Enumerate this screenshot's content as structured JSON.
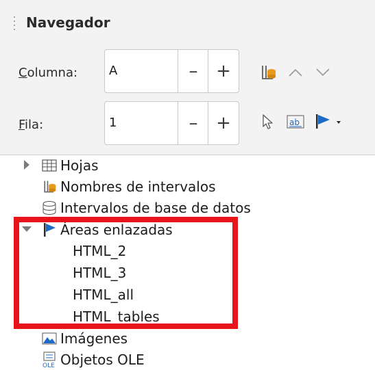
{
  "header": {
    "title": "Navegador"
  },
  "controls": {
    "column_label": "Columna:",
    "column_accel": "C",
    "column_rest": "olumna:",
    "column_value": "A",
    "row_label": "Fila:",
    "row_accel": "F",
    "row_rest": "ila:",
    "row_value": "1",
    "minus": "–",
    "plus": "+"
  },
  "tree": {
    "items": [
      {
        "label": "Hojas",
        "icon": "sheet-grid-icon",
        "expanded": false
      },
      {
        "label": "Nombres de intervalos",
        "icon": "range-names-icon"
      },
      {
        "label": "Intervalos de base de datos",
        "icon": "database-icon"
      },
      {
        "label": "Áreas enlazadas",
        "icon": "linked-area-flag-icon",
        "expanded": true,
        "children": [
          "HTML_2",
          "HTML_3",
          "HTML_all",
          "HTML_tables"
        ]
      },
      {
        "label": "Imágenes",
        "icon": "image-icon"
      },
      {
        "label": "Objetos OLE",
        "icon": "ole-object-icon"
      }
    ]
  },
  "colors": {
    "highlight": "#e8141c",
    "accent_blue": "#1c6bc4",
    "accent_orange": "#e89a1c"
  }
}
